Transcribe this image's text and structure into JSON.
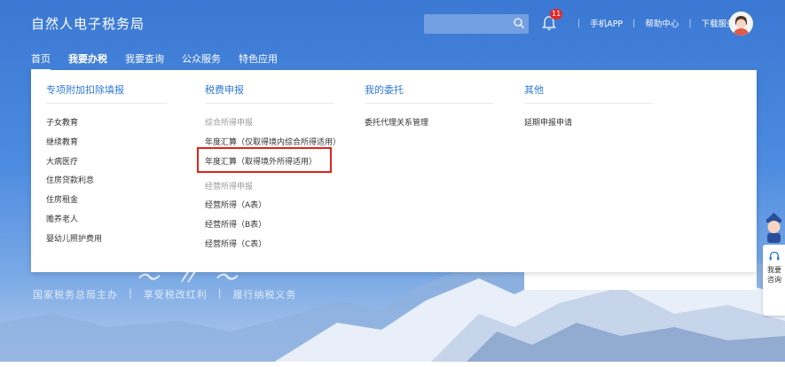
{
  "header": {
    "site_title": "自然人电子税务局",
    "notification_count": "11",
    "links": [
      "手机APP",
      "帮助中心",
      "下载服务"
    ]
  },
  "nav": {
    "items": [
      "首页",
      "我要办税",
      "我要查询",
      "公众服务",
      "特色应用"
    ]
  },
  "dropdown": {
    "columns": [
      {
        "heading": "专项附加扣除填报",
        "items": [
          "子女教育",
          "继续教育",
          "大病医疗",
          "住房贷款利息",
          "住房租金",
          "赡养老人",
          "婴幼儿照护费用"
        ]
      },
      {
        "heading": "税费申报",
        "groups": [
          {
            "label": "综合所得申报",
            "items": [
              "年度汇算（仅取得境内综合所得适用）",
              "年度汇算（取得境外所得适用）"
            ]
          },
          {
            "label": "经营所得申报",
            "items": [
              "经营所得（A表）",
              "经营所得（B表）",
              "经营所得（C表）"
            ]
          }
        ]
      },
      {
        "heading": "我的委托",
        "items": [
          "委托代理关系管理"
        ]
      },
      {
        "heading": "其他",
        "items": [
          "延期申报申请"
        ]
      }
    ]
  },
  "slogan": [
    "国家税务总局主办",
    "享受税改红利",
    "履行纳税义务"
  ],
  "side_widget": {
    "label": "我要咨询"
  },
  "colors": {
    "accent": "#2f7ad8",
    "highlight_border": "#e0231b",
    "badge": "#e02b2b"
  },
  "icons": {
    "search": "search-icon",
    "bell": "bell-icon",
    "avatar": "avatar-icon",
    "headset": "headset-icon"
  }
}
